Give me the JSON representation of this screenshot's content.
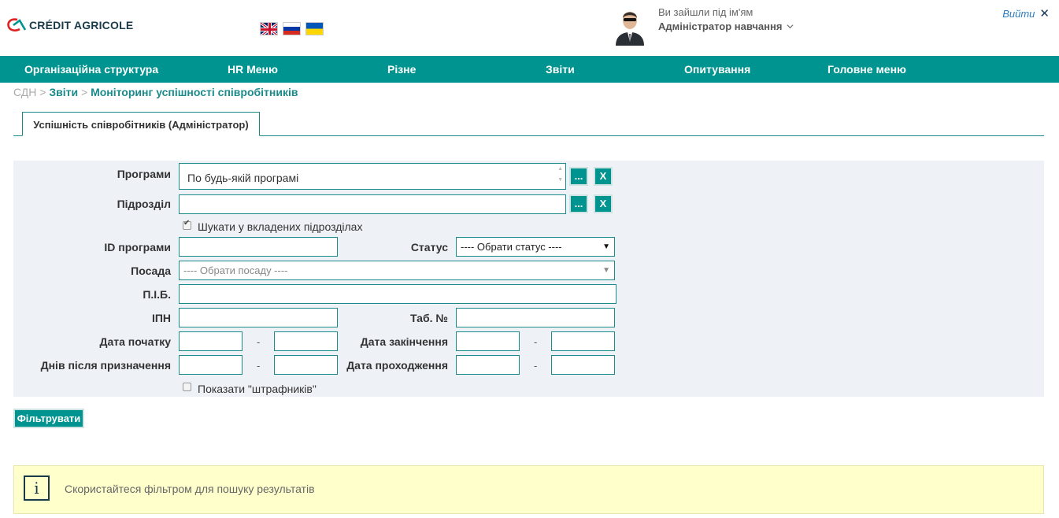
{
  "header": {
    "brand": "CRÉDIT AGRICOLE",
    "languages": [
      {
        "name": "uk-flag-icon"
      },
      {
        "name": "ru-flag-icon"
      },
      {
        "name": "ua-flag-icon"
      }
    ],
    "user_greeting": "Ви зайшли під ім'ям",
    "user_name": "Адміністратор навчання",
    "logout_label": "Вийти",
    "close_symbol": "✕"
  },
  "nav": {
    "items": [
      {
        "label": "Організаційна структура"
      },
      {
        "label": "HR Меню"
      },
      {
        "label": "Різне"
      },
      {
        "label": "Звіти"
      },
      {
        "label": "Опитування"
      },
      {
        "label": "Головне меню"
      }
    ]
  },
  "breadcrumb": {
    "root": "СДН",
    "sep": " > ",
    "items": [
      "Звіти",
      "Моніторинг успішності співробітників"
    ]
  },
  "tab": {
    "label": "Успішність співробітників (Адміністратор)"
  },
  "filter": {
    "programs_label": "Програми",
    "programs_value": "По будь-якій програмі",
    "browse_label": "...",
    "clear_label": "X",
    "division_label": "Підрозділ",
    "division_value": "",
    "search_nested_label": "Шукати у вкладених підрозділах",
    "search_nested_checked": true,
    "program_id_label": "ID програми",
    "status_label": "Статус",
    "status_value": "---- Обрати статус ----",
    "position_label": "Посада",
    "position_value": "---- Обрати посаду ----",
    "name_label": "П.І.Б.",
    "ipn_label": "ІПН",
    "tab_no_label": "Таб. №",
    "start_date_label": "Дата початку",
    "end_date_label": "Дата закінчення",
    "days_after_label": "Днів після призначення",
    "pass_date_label": "Дата проходження",
    "range_sep": "-",
    "penalty_label": "Показати \"штрафників\"",
    "penalty_checked": false,
    "submit_label": "Фільтрувати"
  },
  "info": {
    "icon": "info-icon",
    "symbol": "i",
    "message": "Скористайтеся фільтром для пошуку результатів"
  },
  "colors": {
    "accent": "#009491",
    "info_bg": "#ffffcc",
    "panel_bg": "#eef2f7"
  }
}
